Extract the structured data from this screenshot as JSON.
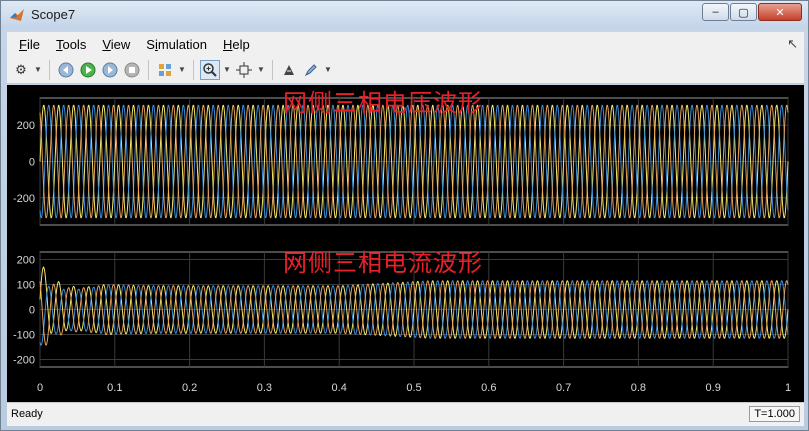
{
  "window": {
    "title": "Scope7",
    "minimize": "‒",
    "maximize": "▢",
    "close": "✕"
  },
  "menu": [
    {
      "label": "File",
      "mnemonic": "F"
    },
    {
      "label": "Tools",
      "mnemonic": "T"
    },
    {
      "label": "View",
      "mnemonic": "V"
    },
    {
      "label": "Simulation",
      "mnemonic": "i"
    },
    {
      "label": "Help",
      "mnemonic": "H"
    }
  ],
  "toolbar": {
    "icons": [
      "gear-icon",
      "step-back-icon",
      "run-icon",
      "step-forward-icon",
      "stop-icon",
      "layout-icon",
      "zoom-in-icon",
      "fit-to-view-icon",
      "cursor-measure-icon",
      "highlight-icon"
    ]
  },
  "plots": [
    {
      "title": "网侧三相电压波形",
      "y_ticks": [
        "200",
        "0",
        "-200"
      ],
      "ylim": [
        -350,
        350
      ]
    },
    {
      "title": "网侧三相电流波形",
      "y_ticks": [
        "200",
        "100",
        "0",
        "-100",
        "-200"
      ],
      "ylim": [
        -230,
        230
      ]
    }
  ],
  "x_ticks": [
    "0",
    "0.1",
    "0.2",
    "0.3",
    "0.4",
    "0.5",
    "0.6",
    "0.7",
    "0.8",
    "0.9",
    "1"
  ],
  "colors": {
    "phase_a": "#f5e66a",
    "phase_b": "#3f8fd6",
    "phase_c": "#e5a25a",
    "title_red": "#e8202a",
    "grid": "#3a3a3a"
  },
  "chart_data": [
    {
      "type": "line",
      "title": "网侧三相电压波形",
      "x": [
        0,
        1
      ],
      "xlim": [
        0,
        1
      ],
      "ylim": [
        -350,
        350
      ],
      "frequency_hz": 50,
      "series": [
        {
          "amplitude": 311,
          "phase_deg": 0
        },
        {
          "amplitude": 311,
          "phase_deg": -120
        },
        {
          "amplitude": 311,
          "phase_deg": 120
        }
      ]
    },
    {
      "type": "line",
      "title": "网侧三相电流波形",
      "xlim": [
        0,
        1
      ],
      "ylim": [
        -230,
        230
      ],
      "frequency_hz": 50,
      "transient_peak": 190,
      "steady_amplitude_0_4": 95,
      "steady_amplitude_1_0": 115,
      "series": [
        {
          "phase_deg": 0
        },
        {
          "phase_deg": -120
        },
        {
          "phase_deg": 120
        }
      ]
    }
  ],
  "status": {
    "left": "Ready",
    "right": "T=1.000"
  }
}
